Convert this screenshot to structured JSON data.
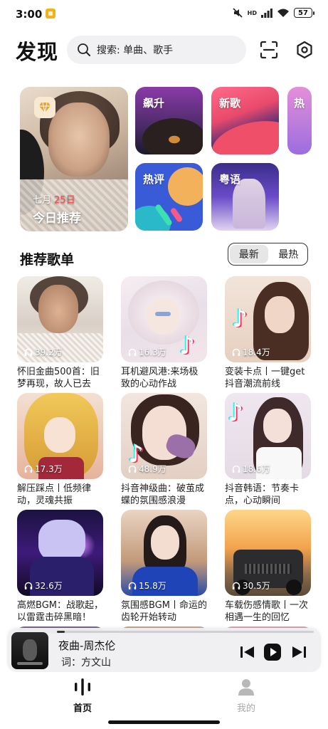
{
  "status_bar": {
    "time": "3:00",
    "battery": "57",
    "hd_label": "HD"
  },
  "header": {
    "title": "发现",
    "search_placeholder": "搜索: 单曲、歌手"
  },
  "discover": {
    "daily": {
      "month": "七月",
      "day": "25日",
      "label": "今日推荐"
    },
    "tiles": {
      "rise": "飙升",
      "new": "新歌",
      "hot": "热",
      "review": "热评",
      "cantonese": "粤语"
    }
  },
  "section": {
    "title": "推荐歌单",
    "sort_options": [
      "最新",
      "最热"
    ],
    "active_sort": "最新"
  },
  "playlists": [
    {
      "count": "39.2万",
      "title": "怀旧金曲500首：旧梦再现，故人已去"
    },
    {
      "count": "16.3万",
      "title": "耳机避风港:来场极致的心动作战"
    },
    {
      "count": "18.4万",
      "title": "变装卡点丨一键get抖音潮流前线"
    },
    {
      "count": "17.3万",
      "title": "解压踩点丨低频律动，灵魂共振"
    },
    {
      "count": "48.9万",
      "title": "抖音神级曲：破茧成蝶的氛围感浪漫"
    },
    {
      "count": "18.6万",
      "title": "抖音韩语：节奏卡点，心动瞬间"
    },
    {
      "count": "32.6万",
      "title": "高燃BGM：战歌起，以雷霆击碎黑暗！"
    },
    {
      "count": "15.8万",
      "title": "氛围感BGM丨命运的齿轮开始转动"
    },
    {
      "count": "30.5万",
      "title": "车载伤感情歌丨一次相遇一生的回忆"
    }
  ],
  "player": {
    "song": "夜曲-周杰伦",
    "lyric": "词：方文山",
    "progress": 0.03
  },
  "bottom_nav": {
    "home": "首页",
    "mine": "我的",
    "active": "home"
  },
  "icons": {
    "search": "search-icon",
    "scan": "scan-icon",
    "settings": "gear-icon",
    "headphones": "headphones-icon",
    "prev": "skip-previous-icon",
    "play": "play-icon",
    "next": "skip-next-icon",
    "home": "equalizer-icon",
    "mine": "person-icon"
  },
  "colors": {
    "accent_red": "#ff4b4b",
    "text": "#111111",
    "muted": "#a8a8a8"
  }
}
